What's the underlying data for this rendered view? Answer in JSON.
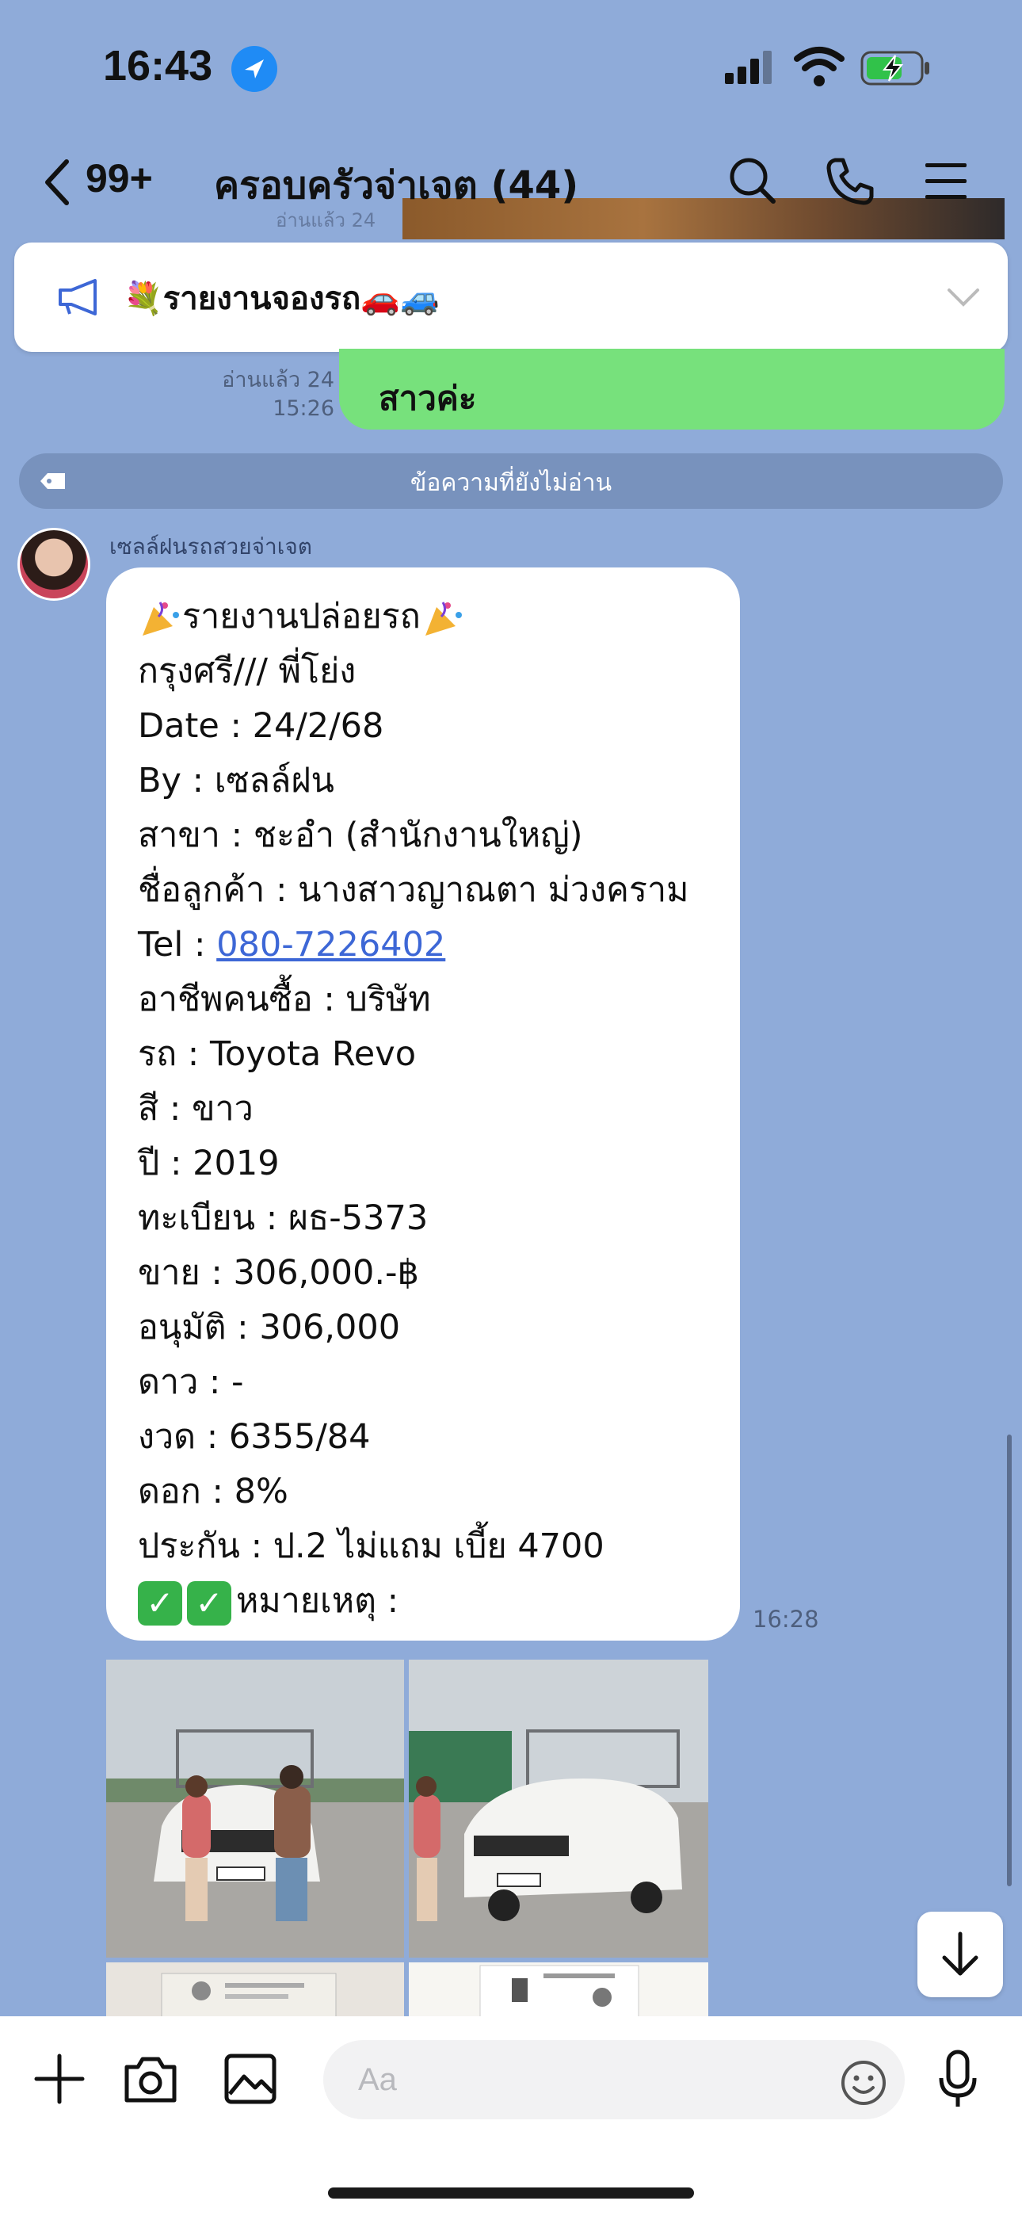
{
  "status_bar": {
    "time": "16:43"
  },
  "header": {
    "unread_count": "99+",
    "title": "ครอบครัวจ่าเจต (44)",
    "behind_text": "อ่านแล้ว 24"
  },
  "pinned": {
    "text": "💐รายงานจองรถ🚗🚙"
  },
  "own_message": {
    "text": "สาวค่ะ",
    "read_status": "อ่านแล้ว 24",
    "time": "15:26"
  },
  "unread_divider": {
    "label": "ข้อความที่ยังไม่อ่าน"
  },
  "incoming_message": {
    "sender": "เซลล์ฝนรถสวยจ่าเจต",
    "time": "16:28",
    "title": "รายงานปล่อยรถ",
    "lines": [
      "กรุงศรี/// พี่โย่ง",
      "Date : 24/2/68",
      "By : เซลล์ฝน",
      "สาขา : ชะอำ (สำนักงานใหญ่)",
      "ชื่อลูกค้า : นางสาวญาณตา ม่วงคราม"
    ],
    "tel_label": "Tel : ",
    "tel_number": "080-7226402",
    "lines_after": [
      "อาชีพคนซื้อ : บริษัท",
      "รถ : Toyota Revo",
      "สี : ขาว",
      "ปี : 2019",
      "ทะเบียน : ผธ-5373",
      "ขาย : 306,000.-฿",
      "อนุมัติ : 306,000",
      "ดาว : -",
      "งวด : 6355/84",
      "ดอก : 8%",
      "ประกัน : ป.2 ไม่แถม เบี้ย 4700"
    ],
    "note_label": "หมายเหตุ :"
  },
  "composer": {
    "placeholder": "Aa"
  },
  "colors": {
    "chat_background": "#8fabd9",
    "own_bubble": "#77e17c",
    "link": "#3d67d6",
    "divider": "#7892bd"
  }
}
